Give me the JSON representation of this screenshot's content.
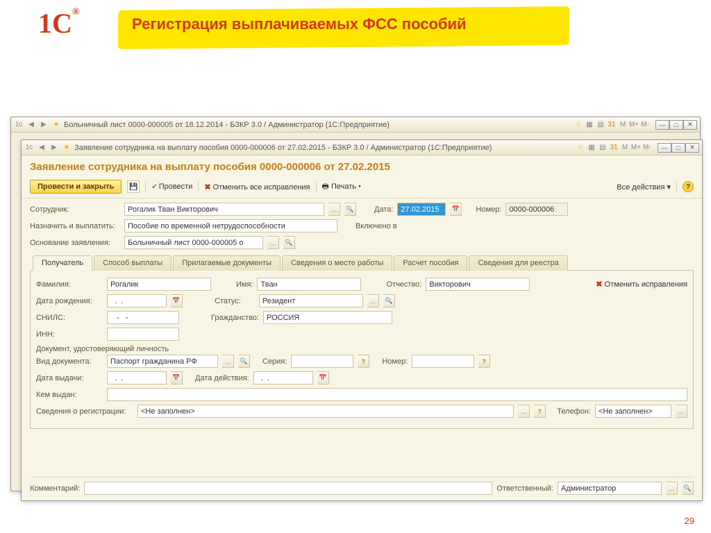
{
  "slide": {
    "title": "Регистрация выплачиваемых ФСС пособий",
    "logo": "1С",
    "page": "29"
  },
  "backWindow": {
    "title": "Больничный лист 0000-000005 от 18.12.2014 - БЗКР 3.0 / Администратор  (1С:Предприятие)"
  },
  "frontWindow": {
    "title": "Заявление сотрудника на выплату пособия 0000-000006 от 27.02.2015 - БЗКР 3.0 / Администратор  (1С:Предприятие)"
  },
  "docTitle": "Заявление сотрудника на выплату пособия 0000-000006 от 27.02.2015",
  "toolbar": {
    "submit": "Провести и закрыть",
    "submit2": "Провести",
    "cancel_all": "Отменить все исправления",
    "print": "Печать",
    "all_actions": "Все действия"
  },
  "header": {
    "employee_lbl": "Сотрудник:",
    "employee_val": "Рогалик Тван Викторович",
    "date_lbl": "Дата:",
    "date_val": "27.02.2015",
    "number_lbl": "Номер:",
    "number_val": "0000-000006",
    "assign_lbl": "Назначить и выплатить:",
    "assign_val": "Пособие по временной нетрудоспособности",
    "included_lbl": "Включено в",
    "basis_lbl": "Основание заявления:",
    "basis_val": "Больничный лист 0000-000005 о"
  },
  "tabs": [
    "Получатель",
    "Способ выплаты",
    "Прилагаемые документы",
    "Сведения о месте работы",
    "Расчет пособия",
    "Сведения для реестра"
  ],
  "recipient": {
    "lastname_lbl": "Фамилия:",
    "lastname_val": "Рогалик",
    "firstname_lbl": "Имя:",
    "firstname_val": "Тван",
    "patronymic_lbl": "Отчество:",
    "patronymic_val": "Викторович",
    "cancel_fix": "Отменить исправления",
    "dob_lbl": "Дата рождения:",
    "dob_val": "  .  .    ",
    "status_lbl": "Статус:",
    "status_val": "Резидент",
    "snils_lbl": "СНИЛС:",
    "snils_val": "   -   -",
    "citizenship_lbl": "Гражданство:",
    "citizenship_val": "РОССИЯ",
    "inn_lbl": "ИНН:",
    "inn_val": "",
    "id_section": "Документ, удостоверяющий личность",
    "doctype_lbl": "Вид документа:",
    "doctype_val": "Паспорт гражданина РФ",
    "series_lbl": "Серия:",
    "series_val": "",
    "docnum_lbl": "Номер:",
    "docnum_val": "",
    "issue_date_lbl": "Дата выдачи:",
    "issue_date_val": "  .  .    ",
    "valid_date_lbl": "Дата действия:",
    "valid_date_val": "  .  .    ",
    "issued_by_lbl": "Кем выдан:",
    "issued_by_val": "",
    "reg_info_lbl": "Сведения о регистрации:",
    "reg_info_val": "<Не заполнен>",
    "phone_lbl": "Телефон:",
    "phone_val": "<Не заполнен>"
  },
  "footer": {
    "comment_lbl": "Комментарий:",
    "comment_val": "",
    "responsible_lbl": "Ответственный:",
    "responsible_val": "Администратор"
  },
  "mem": {
    "m": "M",
    "mp": "M+",
    "mm": "M-"
  }
}
